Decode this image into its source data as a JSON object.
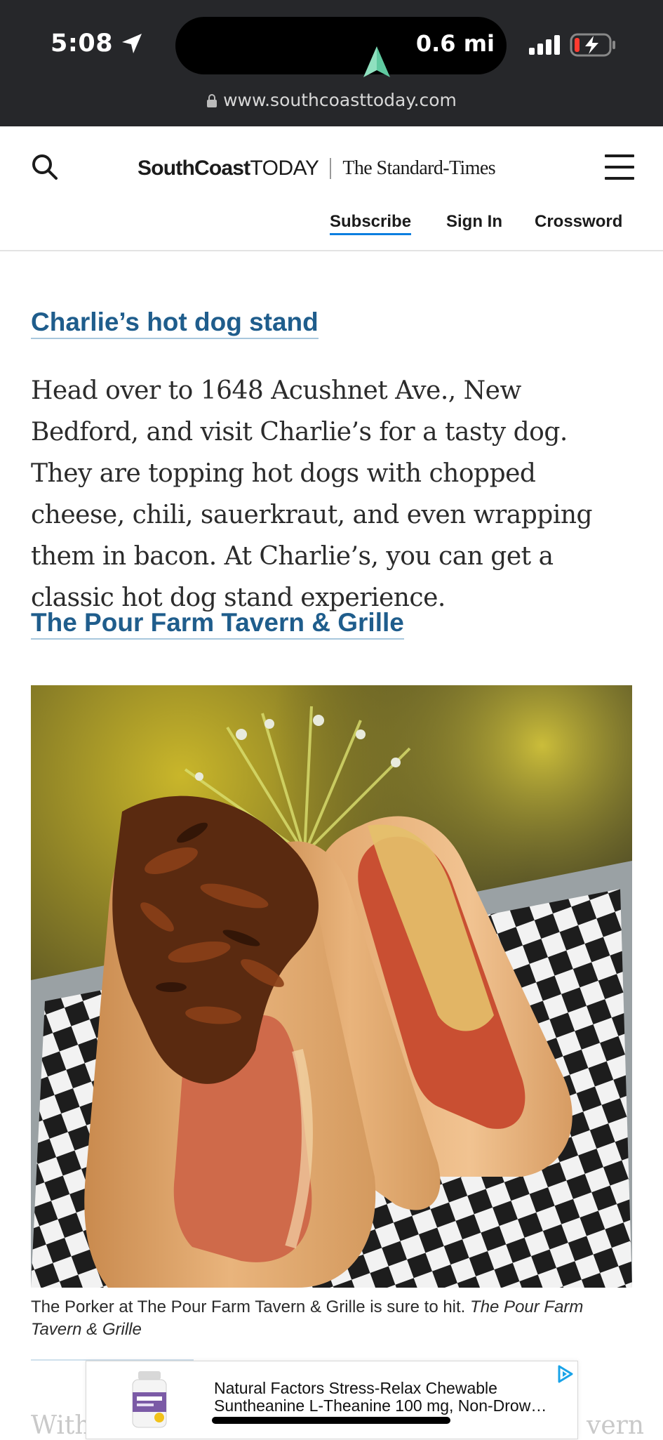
{
  "status_bar": {
    "time": "5:08",
    "distance": "0.6 mi",
    "url": "www.southcoasttoday.com"
  },
  "header": {
    "logo_primary_bold": "SouthCoast",
    "logo_primary_light": "TODAY",
    "logo_secondary": "The Standard-Times",
    "links": {
      "subscribe": "Subscribe",
      "sign_in": "Sign In",
      "crossword": "Crossword"
    }
  },
  "article": {
    "section1_title": "Charlie’s hot dog stand",
    "section1_body": "Head over to 1648 Acushnet Ave., New Bedford, and visit Charlie’s for a tasty dog. They are topping hot dogs with chopped cheese, chili, sauerkraut, and even wrapping them in bacon. At Charlie’s, you can get a classic hot dog stand experience.",
    "section2_title": "The Pour Farm Tavern & Grille",
    "photo_caption": "The Porker at The Pour Farm Tavern & Grille is sure to hit.",
    "photo_credit": "The Pour Farm Tavern & Grille",
    "next_para_start": "With",
    "next_para_end": "vern"
  },
  "ad": {
    "line1": "Natural Factors Stress-Relax Chewable",
    "line2": "Suntheanine L-Theanine 100 mg, Non-Drow…"
  },
  "colors": {
    "link_blue": "#1f5d8c",
    "subscribe_underline": "#0b7ee0",
    "status_bar_bg": "#26272a"
  }
}
